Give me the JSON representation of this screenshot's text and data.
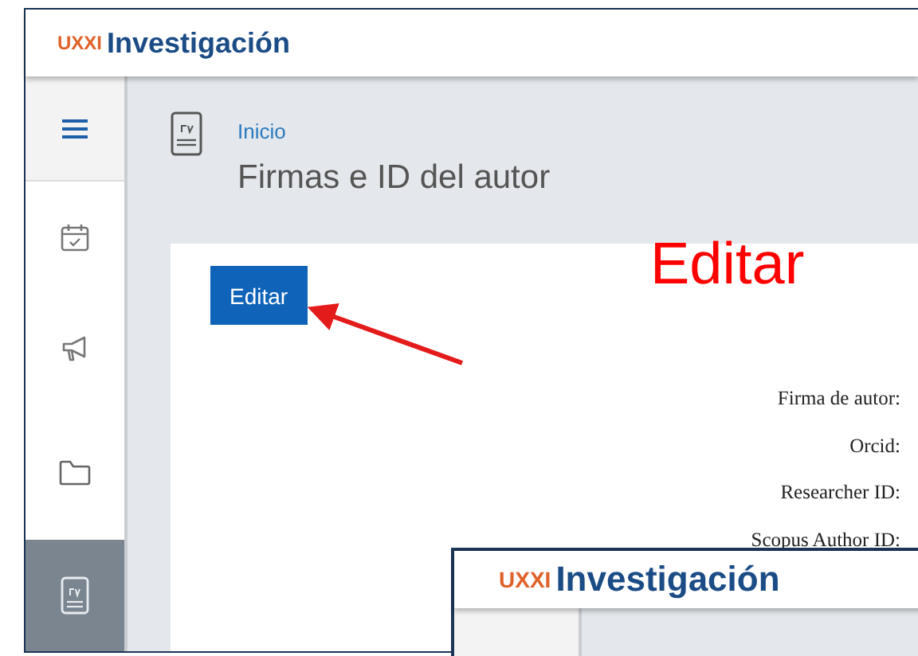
{
  "header": {
    "logo_mark": "UXXI",
    "app_name": "Investigación"
  },
  "sidebar": {
    "items": [
      {
        "kind": "menu",
        "selected": false
      },
      {
        "kind": "calendar",
        "selected": false
      },
      {
        "kind": "megaphone",
        "selected": false
      },
      {
        "kind": "folder",
        "selected": false
      },
      {
        "kind": "cv",
        "selected": true
      }
    ]
  },
  "breadcrumb": "Inicio",
  "page_title": "Firmas e ID del autor",
  "card": {
    "button": "Editar",
    "fields": [
      "Firma de autor:",
      "Orcid:",
      "Researcher ID:",
      "Scopus Author ID:"
    ]
  },
  "annotation": {
    "text": "Editar"
  },
  "overlay_window": {
    "logo_mark": "UXXI",
    "app_name": "Investigación"
  }
}
